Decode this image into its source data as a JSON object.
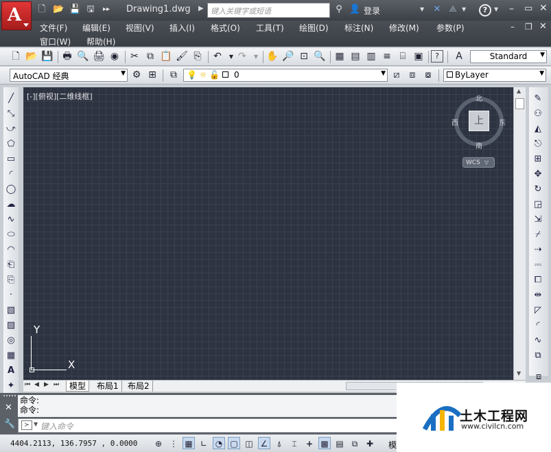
{
  "app": {
    "logo_letter": "A",
    "doc_title": "Drawing1.dwg",
    "search_placeholder": "键入关键字或短语",
    "login_label": "登录",
    "help_icon": "?"
  },
  "menu": {
    "row1": [
      "文件(F)",
      "编辑(E)",
      "视图(V)",
      "插入(I)",
      "格式(O)",
      "工具(T)",
      "绘图(D)",
      "标注(N)",
      "修改(M)",
      "参数(P)"
    ],
    "row2": [
      "窗口(W)",
      "帮助(H)"
    ]
  },
  "toolbar": {
    "text_style": "Standard",
    "workspace": "AutoCAD 经典",
    "layer": "0",
    "color": "ByLayer"
  },
  "viewport": {
    "label": "[-][俯视][二维线框]",
    "compass": {
      "north": "北",
      "south": "南",
      "east": "东",
      "west": "西",
      "top": "上"
    },
    "wcs": "WCS",
    "ucs_y": "Y",
    "ucs_x": "X"
  },
  "tabs": [
    "模型",
    "布局1",
    "布局2"
  ],
  "command": {
    "line1": "命令:",
    "line2": "命令:",
    "placeholder": "键入命令"
  },
  "status": {
    "coords": "4404.2113, 136.7957 , 0.0000",
    "model_label": "模型"
  },
  "watermark": {
    "name": "土木工程网",
    "url": "www.civilcn.com"
  },
  "colors": {
    "canvas": "#2d3341",
    "logo": "#d42a2a",
    "accent": "#1a6fc2"
  }
}
